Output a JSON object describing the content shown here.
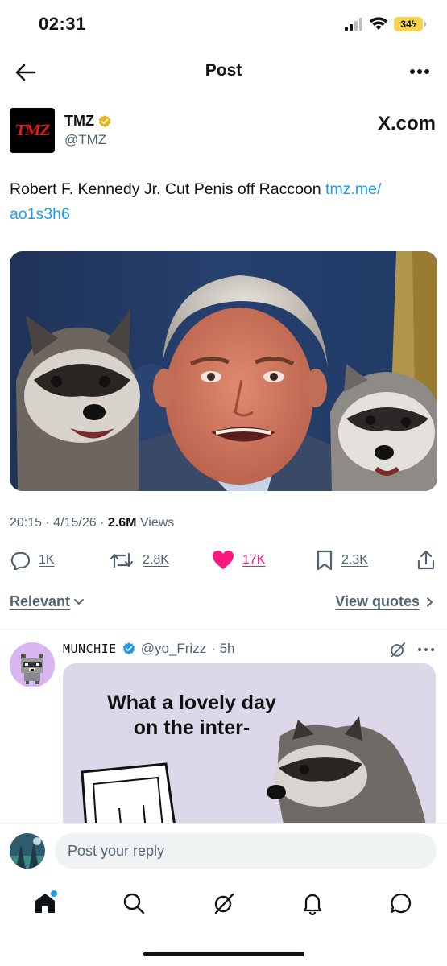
{
  "status_bar": {
    "time": "02:31",
    "battery": "34"
  },
  "nav": {
    "title": "Post"
  },
  "post": {
    "author_name": "TMZ",
    "author_handle": "@TMZ",
    "avatar_text": "TMZ",
    "source": "X.com",
    "text": "Robert F. Kennedy Jr. Cut Penis off Raccoon ",
    "link": "tmz.me/ ao1s3h6",
    "time": "20:15 · 4/15/26 · ",
    "views_count": "2.6M",
    "views_label": " Views",
    "replies": "1K",
    "reposts": "2.8K",
    "likes": "17K",
    "bookmarks": "2.3K",
    "liked": true
  },
  "sort": {
    "label": "Relevant",
    "view_quotes": "View quotes"
  },
  "reply": {
    "name": "MUNCHIE",
    "handle": "@yo_Frizz",
    "time": "· 5h",
    "media_text": "What a lovely day on the inter-"
  },
  "compose": {
    "placeholder": "Post your reply"
  },
  "tabs": [
    "home",
    "search",
    "grok",
    "notifications",
    "messages"
  ],
  "colors": {
    "accent": "#1d9bf0",
    "like": "#f91880",
    "verified_gold": "#e2b719",
    "verified_blue": "#1d9bf0",
    "muted": "#536471"
  }
}
